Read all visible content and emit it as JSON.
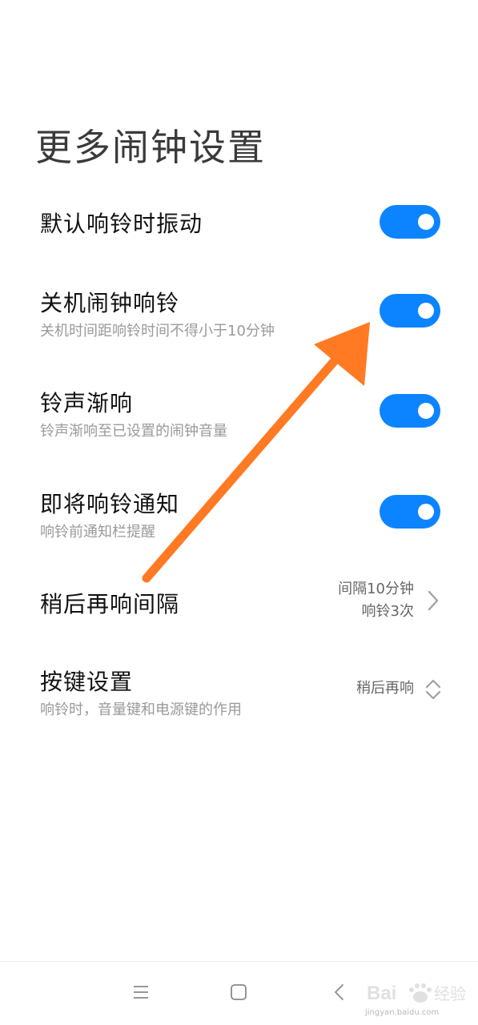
{
  "header": {
    "title": "更多闹钟设置"
  },
  "settings": [
    {
      "title": "默认响铃时振动",
      "subtitle": "",
      "toggle_on": true
    },
    {
      "title": "关机闹钟响铃",
      "subtitle": "关机时间距响铃时间不得小于10分钟",
      "toggle_on": true
    },
    {
      "title": "铃声渐响",
      "subtitle": "铃声渐响至已设置的闹钟音量",
      "toggle_on": true
    },
    {
      "title": "即将响铃通知",
      "subtitle": "响铃前通知栏提醒",
      "toggle_on": true
    },
    {
      "title": "稍后再响间隔",
      "value_line1": "间隔10分钟",
      "value_line2": "响铃3次"
    },
    {
      "title": "按键设置",
      "subtitle": "响铃时，音量键和电源键的作用",
      "value": "稍后再响"
    }
  ],
  "watermark": {
    "logo": "Bai 经验",
    "url": "jingyan.baidu.com"
  },
  "colors": {
    "toggle_on": "#0d84ff",
    "arrow": "#ff7a22",
    "title": "#3a3a3a",
    "subtitle": "#9a9a9a"
  },
  "icons": {
    "nav_menu": "menu-icon",
    "nav_home": "home-square-icon",
    "nav_back": "back-chevron-icon",
    "row_chevron": "chevron-right-icon",
    "row_updown": "updown-chevron-icon"
  }
}
